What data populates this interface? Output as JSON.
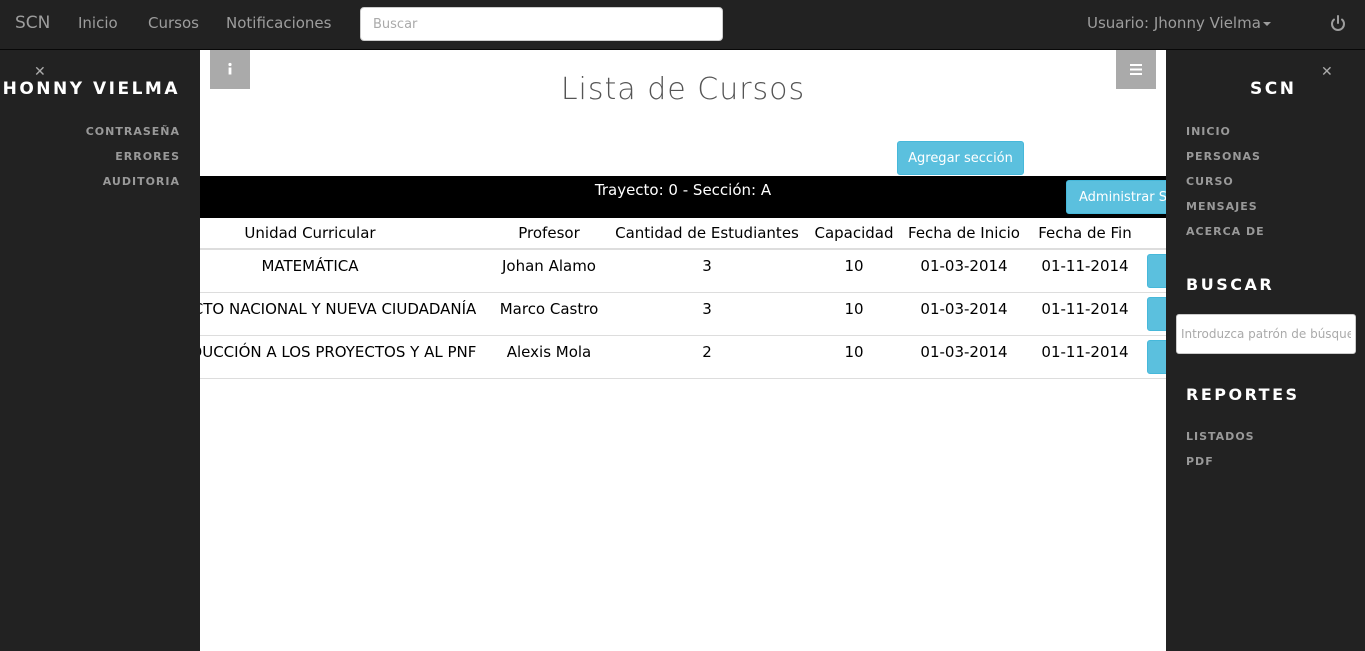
{
  "navbar": {
    "brand": "SCN",
    "links": [
      "Inicio",
      "Cursos",
      "Notificaciones"
    ],
    "search_placeholder": "Buscar",
    "user": "Usuario: Jhonny Vielma",
    "power_icon": "power-icon"
  },
  "left_sidebar": {
    "title": "JHONNY VIELMA",
    "items": [
      "CONTRASEÑA",
      "ERRORES",
      "AUDITORIA"
    ]
  },
  "right_sidebar": {
    "title": "SCN",
    "nav_items": [
      "INICIO",
      "PERSONAS",
      "CURSO",
      "MENSAJES",
      "ACERCA DE"
    ],
    "search_title": "BUSCAR",
    "search_placeholder": "Introduzca patrón de búsqueda",
    "reports_title": "REPORTES",
    "report_items": [
      "LISTADOS",
      "PDF"
    ]
  },
  "main": {
    "title": "Lista de Cursos",
    "info_icon": "info-icon",
    "menu_icon": "menu-icon",
    "add_section_label": "Agregar sección",
    "section_label": "Trayecto: 0 - Sección: A",
    "manage_section_label": "Administrar Sección",
    "table": {
      "headers": [
        "Unidad Curricular",
        "Profesor",
        "Cantidad de Estudiantes",
        "Capacidad",
        "Fecha de Inicio",
        "Fecha de Fin"
      ],
      "rows": [
        [
          "MATEMÁTICA",
          "Johan Alamo",
          "3",
          "10",
          "01-03-2014",
          "01-11-2014"
        ],
        [
          "PROYECTO NACIONAL Y NUEVA CIUDADANÍA",
          "Marco Castro",
          "3",
          "10",
          "01-03-2014",
          "01-11-2014"
        ],
        [
          "INTRODUCCIÓN A LOS PROYECTOS Y AL PNF",
          "Alexis Mola",
          "2",
          "10",
          "01-03-2014",
          "01-11-2014"
        ]
      ]
    }
  },
  "colors": {
    "navbar_bg": "#222222",
    "accent": "#5bc0de",
    "section_bar": "#000000"
  }
}
